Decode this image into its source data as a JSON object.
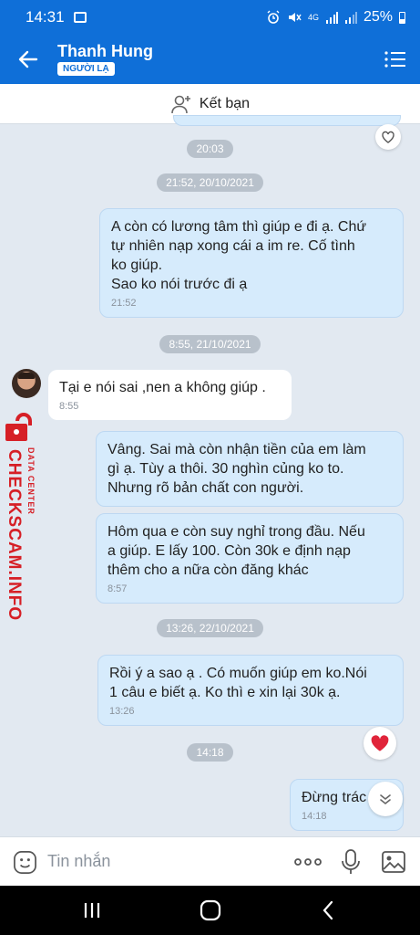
{
  "status_bar": {
    "time": "14:31",
    "network": "4G",
    "battery": "25%"
  },
  "header": {
    "contact_name": "Thanh Hung",
    "badge": "NGƯỜI LẠ"
  },
  "add_friend": {
    "label": "Kết bạn"
  },
  "messages": [
    {
      "type": "separator",
      "text": "20:03"
    },
    {
      "type": "separator",
      "text": "21:52, 20/10/2021"
    },
    {
      "type": "outgoing",
      "lines": [
        "A còn có lương tâm thì giúp e đi ạ. Chứ",
        "tự nhiên nạp xong cái a im re. Cố tình",
        "ko giúp.",
        "Sao ko nói trước đi ạ"
      ],
      "time": "21:52"
    },
    {
      "type": "separator",
      "text": "8:55, 21/10/2021"
    },
    {
      "type": "incoming",
      "lines": [
        "Tại e nói sai ,nen a không giúp ."
      ],
      "time": "8:55"
    },
    {
      "type": "outgoing",
      "lines": [
        "Vâng. Sai mà còn nhận tiền của em làm",
        "gì ạ. Tùy a thôi. 30 nghìn củng ko to.",
        "Nhưng rõ bản chất con người."
      ],
      "time": ""
    },
    {
      "type": "outgoing",
      "lines": [
        "Hôm qua e còn suy nghỉ trong đầu. Nếu",
        "a giúp. E lấy 100. Còn 30k e định nạp",
        "thêm cho a nữa còn đăng khác"
      ],
      "time": "8:57"
    },
    {
      "type": "separator",
      "text": "13:26, 22/10/2021"
    },
    {
      "type": "outgoing",
      "lines": [
        "Rồi ý a sao ạ . Có muốn giúp em ko.Nói",
        "1 câu e biết ạ. Ko thì e xin lại 30k ạ."
      ],
      "time": "13:26"
    },
    {
      "type": "separator",
      "text": "14:18"
    },
    {
      "type": "outgoing",
      "lines": [
        "Đừng trác"
      ],
      "time": "14:18"
    }
  ],
  "watermark": {
    "brand": "CHECKSCAM.INFO",
    "tagline": "DATA CENTER"
  },
  "composer": {
    "placeholder": "Tin nhắn"
  },
  "colors": {
    "header_blue": "#0f6fd8",
    "outgoing_bubble": "#d6ebfc",
    "chat_bg": "#e2e9f1",
    "heart_red": "#e0243a",
    "watermark_red": "#d61f26"
  },
  "icons": [
    "back-arrow-icon",
    "menu-list-icon",
    "add-person-icon",
    "heart-icon",
    "emoji-icon",
    "more-dots-icon",
    "mic-icon",
    "image-icon",
    "chevron-down-icon",
    "recent-apps-icon",
    "home-icon",
    "nav-back-icon"
  ]
}
